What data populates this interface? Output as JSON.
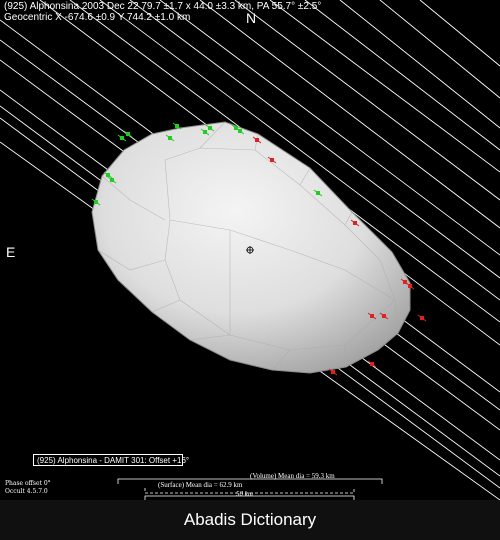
{
  "header": {
    "line1": "(925) Alphonsina  2003 Dec 22  79.7 ±1.7 x 44.0 ±3.3 km, PA 55.7° ±2.5°",
    "line2": "Geocentric  X  -674.6 ±0.9  Y 744.2 ±1.0 km"
  },
  "compass": {
    "north": "N",
    "east": "E"
  },
  "model_label": "(925) Alphonsina - DAMIT 301: Offset +16°",
  "footer": {
    "phase_offset": "Phase offset 0°",
    "occult_version": "Occult 4.5.7.0",
    "volume_dia": "(Volume) Mean dia = 59.3 km",
    "surface_dia": "(Surface) Mean dia = 62.9 km",
    "scale_km": "50 km"
  },
  "banner": "Abadis Dictionary",
  "colors": {
    "background": "#000000",
    "chord": "#ffffff",
    "positive_marker": "#22cc22",
    "negative_marker": "#dd2222",
    "asteroid_shape": "#d6d6d6"
  }
}
